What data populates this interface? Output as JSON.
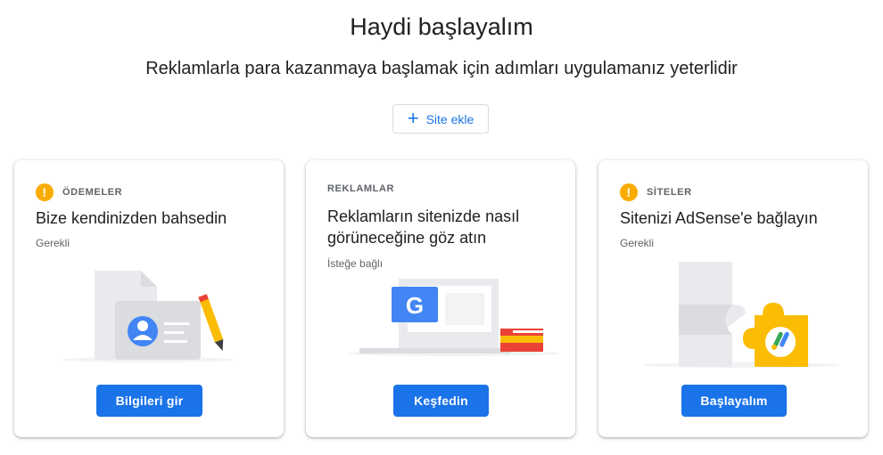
{
  "header": {
    "title": "Haydi başlayalım",
    "subtitle": "Reklamlarla para kazanmaya başlamak için adımları uygulamanız yeterlidir"
  },
  "add_site": {
    "icon": "plus-icon",
    "label": "Site ekle"
  },
  "colors": {
    "accent": "#1a73e8",
    "warning": "#f9ab00",
    "google_blue": "#4285f4",
    "google_red": "#ea4335",
    "google_yellow": "#fbbc04",
    "google_green": "#34a853"
  },
  "cards": [
    {
      "eyebrow": "ÖDEMELER",
      "warning_icon": "!",
      "title": "Bize kendinizden bahsedin",
      "status": "Gerekli",
      "button": "Bilgileri gir"
    },
    {
      "eyebrow": "REKLAMLAR",
      "title": "Reklamların sitenizde nasıl görüneceğine göz atın",
      "status": "İsteğe bağlı",
      "button": "Keşfedin",
      "illustration_badge": "G"
    },
    {
      "eyebrow": "SİTELER",
      "warning_icon": "!",
      "title": "Sitenizi AdSense'e bağlayın",
      "status": "Gerekli",
      "button": "Başlayalım"
    }
  ]
}
